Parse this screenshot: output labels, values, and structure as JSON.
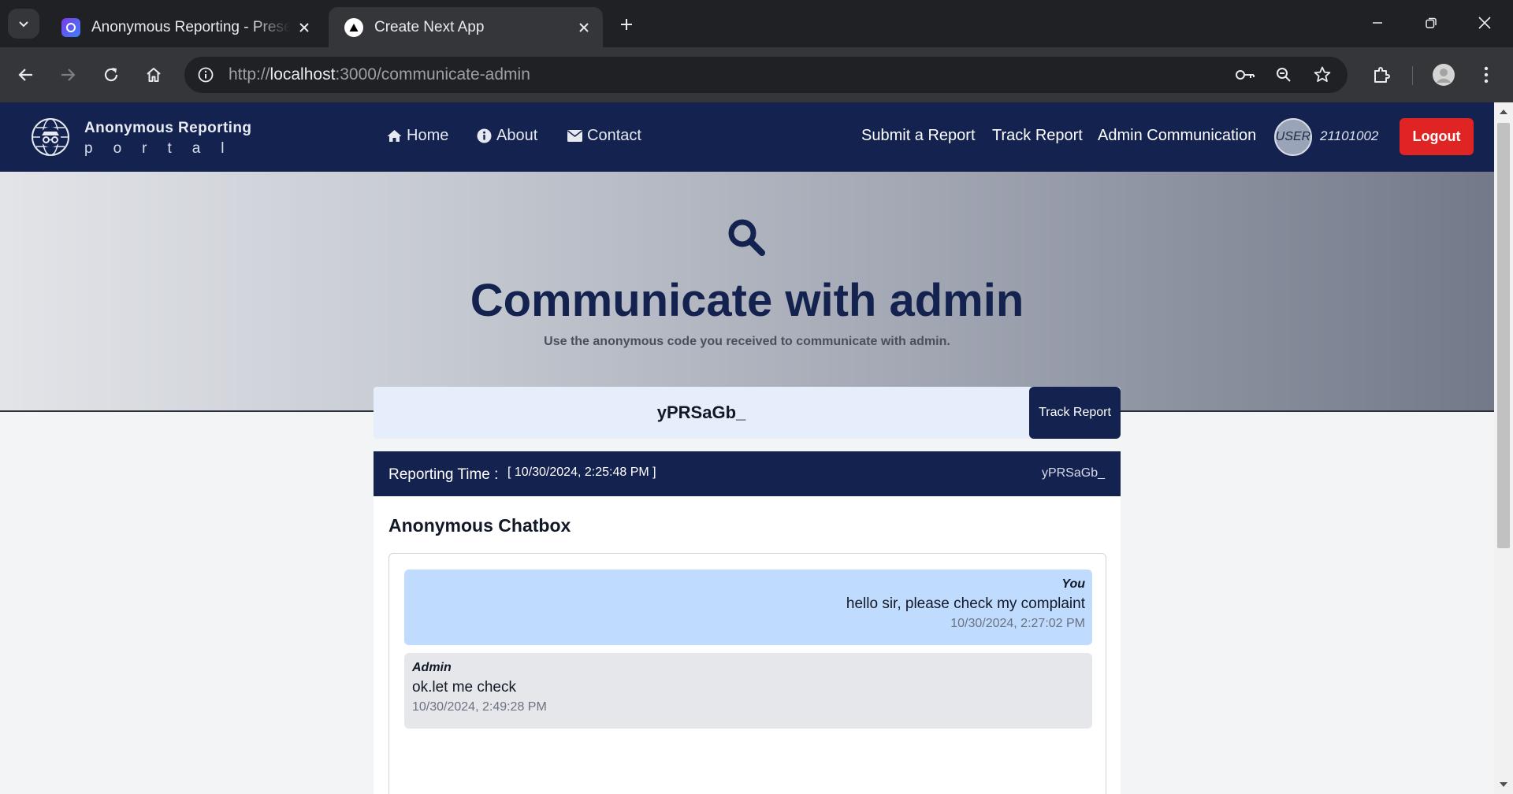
{
  "browser": {
    "tabs": [
      {
        "title": "Anonymous Reporting - Presentation",
        "active": false
      },
      {
        "title": "Create Next App",
        "active": true
      }
    ],
    "url_scheme": "http://",
    "url_host": "localhost",
    "url_rest": ":3000/communicate-admin"
  },
  "site": {
    "brand_line1": "Anonymous Reporting",
    "brand_line2": "portal",
    "nav": {
      "home": "Home",
      "about": "About",
      "contact": "Contact",
      "submit": "Submit a Report",
      "track": "Track Report",
      "admin": "Admin Communication"
    },
    "user": {
      "avatar_text": "USER",
      "id": "21101002"
    },
    "logout": "Logout",
    "colors": {
      "navy": "#14224f",
      "logout": "#e02424",
      "you_bubble": "#bfdbfe",
      "admin_bubble": "#e5e7eb"
    }
  },
  "hero": {
    "title": "Communicate with admin",
    "subtitle": "Use the anonymous code you received to communicate with admin."
  },
  "tracker": {
    "code": "yPRSaGb_",
    "button": "Track Report"
  },
  "report": {
    "time_label": "Reporting Time :",
    "time_value": "[ 10/30/2024, 2:25:48 PM ]",
    "code": "yPRSaGb_"
  },
  "chat": {
    "title": "Anonymous Chatbox",
    "messages": [
      {
        "sender": "You",
        "text": "hello sir, please check my complaint",
        "time": "10/30/2024, 2:27:02 PM"
      },
      {
        "sender": "Admin",
        "text": "ok.let me check",
        "time": "10/30/2024, 2:49:28 PM"
      }
    ]
  }
}
